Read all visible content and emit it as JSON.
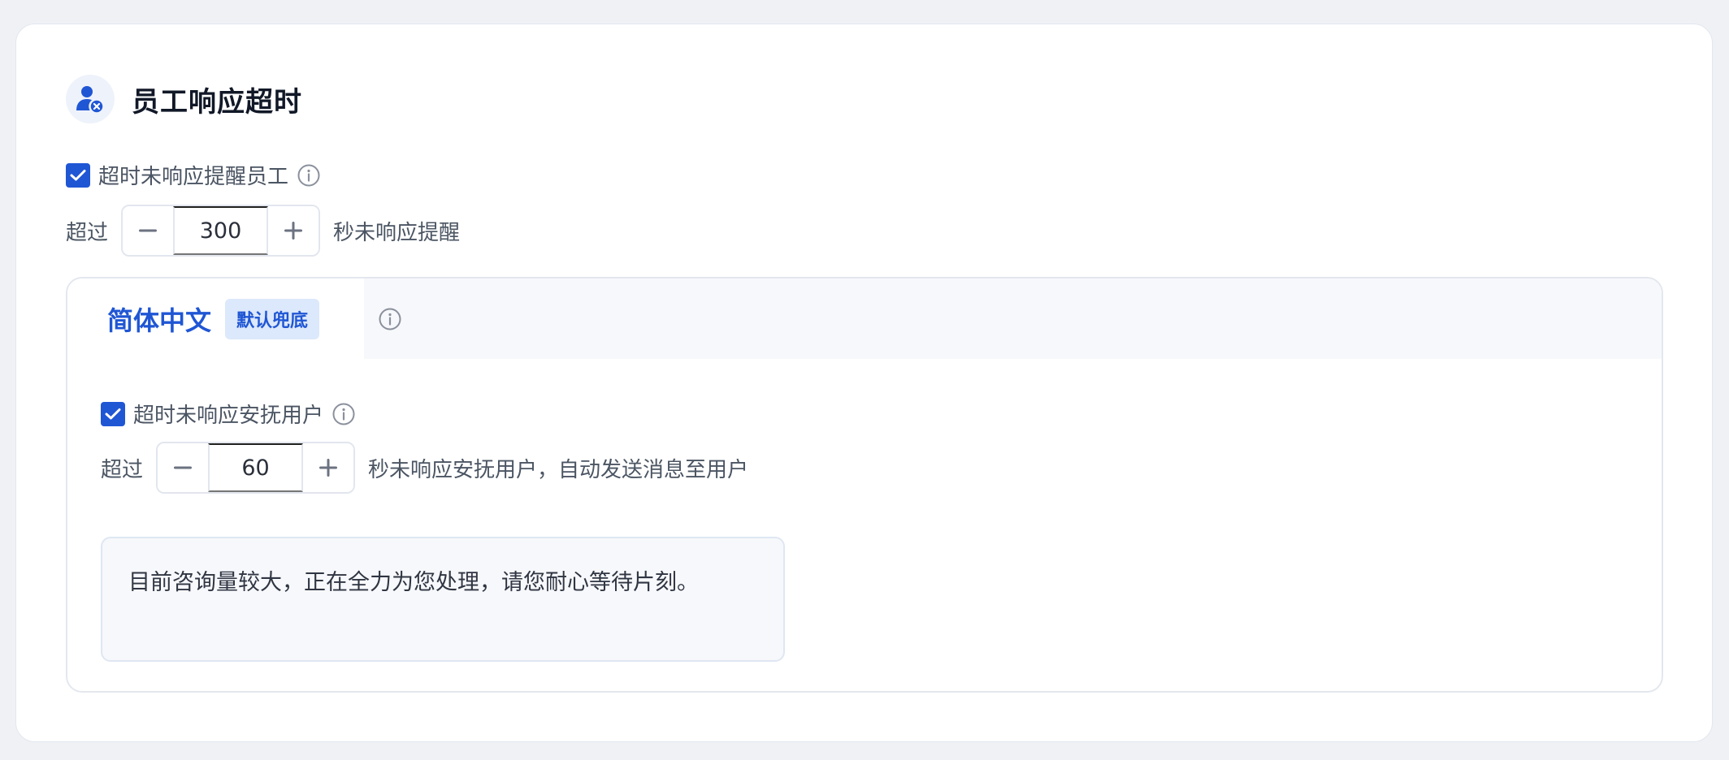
{
  "section": {
    "title": "员工响应超时",
    "icon": "user-timeout-icon"
  },
  "staff_reminder": {
    "checkbox_label": "超时未响应提醒员工",
    "checked": true,
    "prefix": "超过",
    "value": "300",
    "suffix": "秒未响应提醒"
  },
  "language_tabs": [
    {
      "label": "简体中文",
      "badge": "默认兜底",
      "active": true
    }
  ],
  "user_comfort": {
    "checkbox_label": "超时未响应安抚用户",
    "checked": true,
    "prefix": "超过",
    "value": "60",
    "suffix": "秒未响应安抚用户，自动发送消息至用户",
    "message": "目前咨询量较大，正在全力为您处理，请您耐心等待片刻。"
  },
  "colors": {
    "accent": "#1f56d4",
    "badge_bg": "#dce8fb",
    "page_bg": "#eff1f5"
  }
}
